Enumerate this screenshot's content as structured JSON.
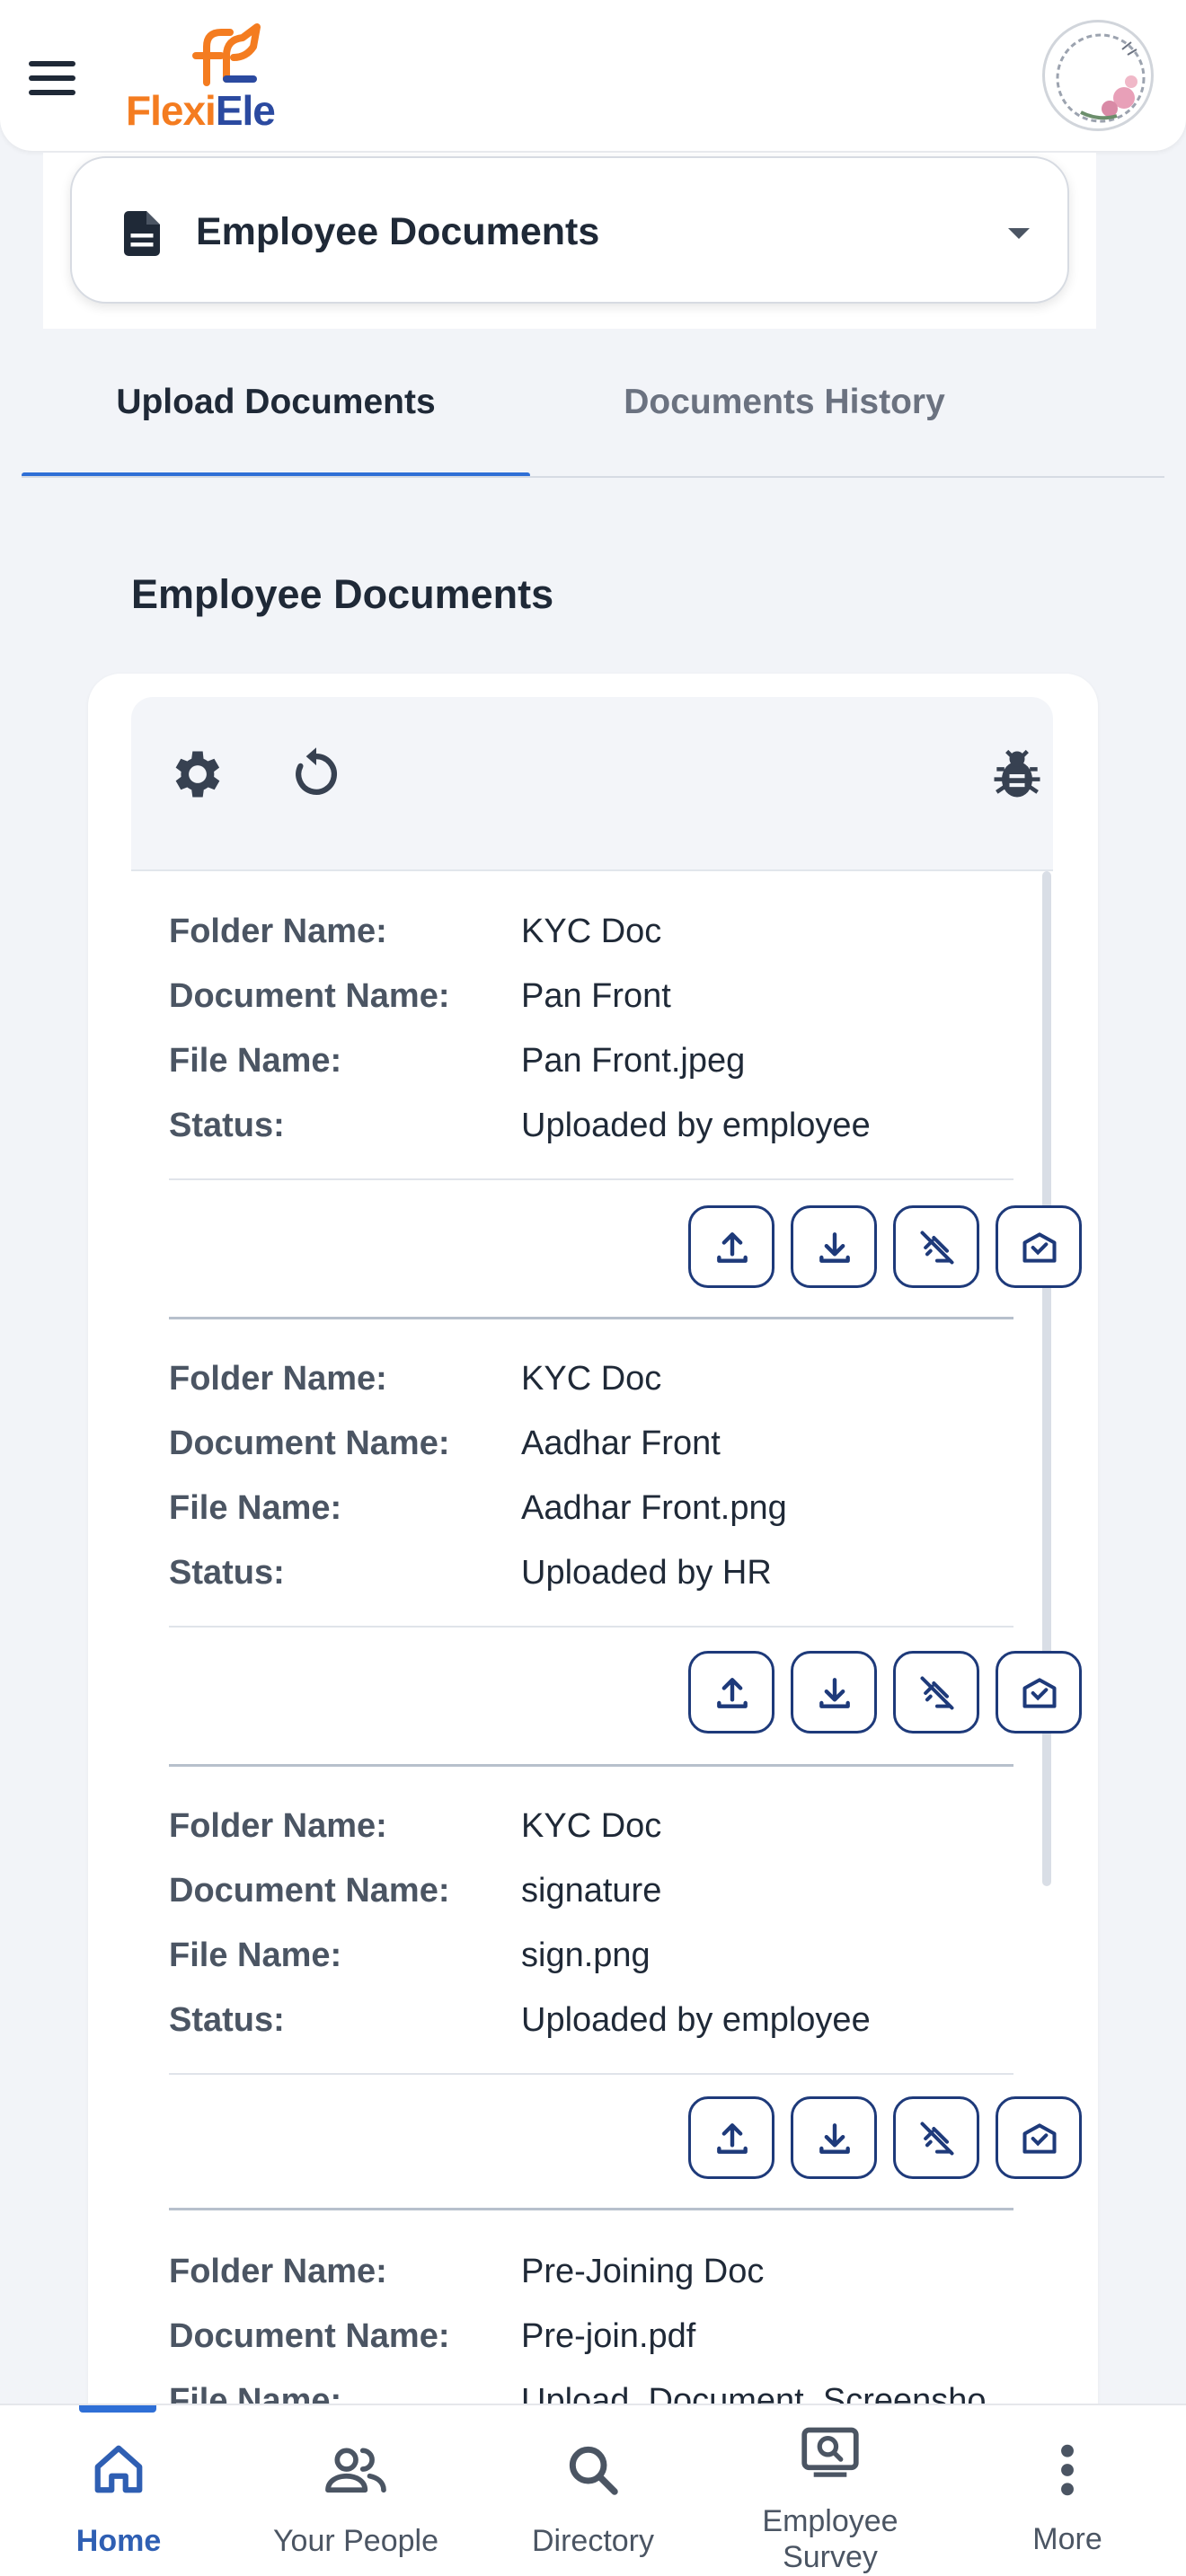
{
  "app": {
    "logo_part1": "Flexi",
    "logo_part2": "Ele"
  },
  "selector": {
    "title": "Employee Documents"
  },
  "tabs": [
    {
      "label": "Upload Documents",
      "active": true
    },
    {
      "label": "Documents History",
      "active": false
    }
  ],
  "section_title": "Employee Documents",
  "labels": {
    "folder": "Folder Name:",
    "document": "Document Name:",
    "file": "File Name:",
    "status": "Status:"
  },
  "documents": [
    {
      "folder": "KYC Doc",
      "document": "Pan Front",
      "file": "Pan Front.jpeg",
      "status": "Uploaded by employee"
    },
    {
      "folder": "KYC Doc",
      "document": "Aadhar Front",
      "file": "Aadhar Front.png",
      "status": "Uploaded by HR"
    },
    {
      "folder": "KYC Doc",
      "document": "signature",
      "file": "sign.png",
      "status": "Uploaded by employee"
    },
    {
      "folder": "Pre-Joining Doc",
      "document": "Pre-join.pdf",
      "file": "Upload_Document_Screensho",
      "status": ""
    }
  ],
  "nav": [
    {
      "label": "Home",
      "icon": "home-icon",
      "active": true
    },
    {
      "label": "Your People",
      "icon": "people-icon",
      "active": false
    },
    {
      "label": "Directory",
      "icon": "search-icon",
      "active": false
    },
    {
      "label": "Employee Survey",
      "line1": "Employee",
      "line2": "Survey",
      "icon": "survey-icon",
      "active": false
    },
    {
      "label": "More",
      "icon": "more-vertical-icon",
      "active": false
    }
  ],
  "colors": {
    "accent": "#2f6fd6",
    "brand_orange": "#f47c20",
    "brand_blue": "#2b4aa0",
    "action_border": "#1e3a7a"
  }
}
